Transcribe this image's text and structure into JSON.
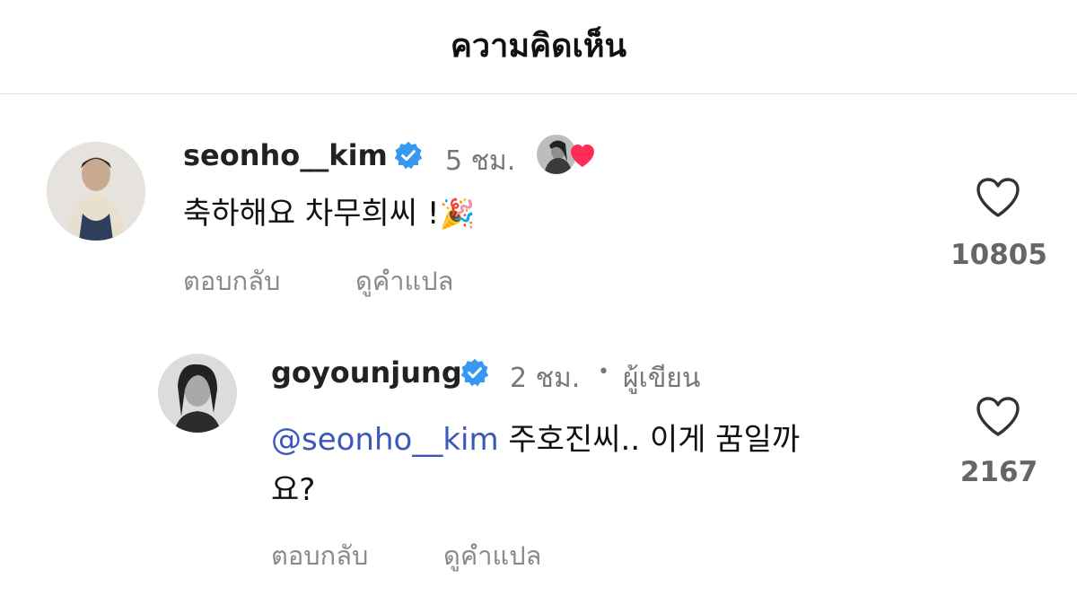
{
  "header": {
    "title": "ความคิดเห็น"
  },
  "comments": [
    {
      "username": "seonho__kim",
      "verified": true,
      "time": "5 ชม.",
      "text": "축하해요 차무희씨 !",
      "emoji": "🎉",
      "reply_label": "ตอบกลับ",
      "translate_label": "ดูคำแปล",
      "like_count": "10805",
      "liked_by_author": true,
      "icons": [
        "verified-badge-icon",
        "heart-icon",
        "party-popper-icon"
      ]
    },
    {
      "username": "goyounjung",
      "verified": true,
      "time": "2 ชม.",
      "separator": "•",
      "author_label": "ผู้เขียน",
      "mention": "@seonho__kim",
      "text_line1": " 주호진씨.. 이게 꿈일까",
      "text_line2": "요?",
      "reply_label": "ตอบกลับ",
      "translate_label": "ดูคำแปล",
      "like_count": "2167",
      "icons": [
        "verified-badge-icon",
        "heart-icon"
      ]
    }
  ],
  "colors": {
    "verified_blue": "#3897f0",
    "mention_blue": "#3b57b8",
    "heart_red": "#ff2d55",
    "muted_text": "#8a8a8a"
  }
}
